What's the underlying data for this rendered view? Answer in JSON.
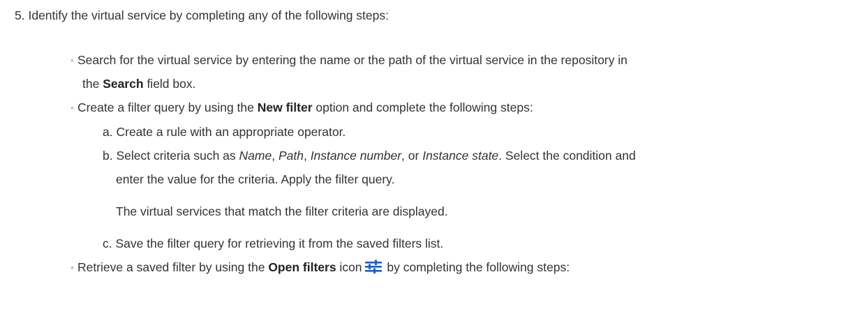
{
  "step": {
    "number": "5.",
    "text": "Identify the virtual service by completing any of the following steps:"
  },
  "bullets": {
    "marker": "◦",
    "search": {
      "line1": "Search for the virtual service by entering the name or the path of the virtual service in the repository in",
      "line2_before": "the ",
      "line2_bold": "Search",
      "line2_after": " field box."
    },
    "filter": {
      "before": "Create a filter query by using the ",
      "bold": "New filter",
      "after": " option and complete the following steps:"
    },
    "retrieve": {
      "before": "Retrieve a saved filter by using the ",
      "bold": "Open filters",
      "middle": " icon",
      "after": " by completing the following steps:"
    }
  },
  "substeps": {
    "a": {
      "marker": "a.",
      "text": "Create a rule with an appropriate operator."
    },
    "b": {
      "marker": "b.",
      "before": "Select criteria such as ",
      "c1": "Name",
      "sep1": ", ",
      "c2": "Path",
      "sep2": ", ",
      "c3": "Instance number",
      "sep3": ", or ",
      "c4": "Instance state",
      "after": ". Select the condition and",
      "line2": "enter the value for the criteria. Apply the filter query.",
      "result": "The virtual services that match the filter criteria are displayed."
    },
    "c": {
      "marker": "c.",
      "text": "Save the filter query for retrieving it from the saved filters list."
    }
  },
  "icons": {
    "open_filters": "open-filters-icon",
    "open_filters_color": "#1f5fbf"
  }
}
